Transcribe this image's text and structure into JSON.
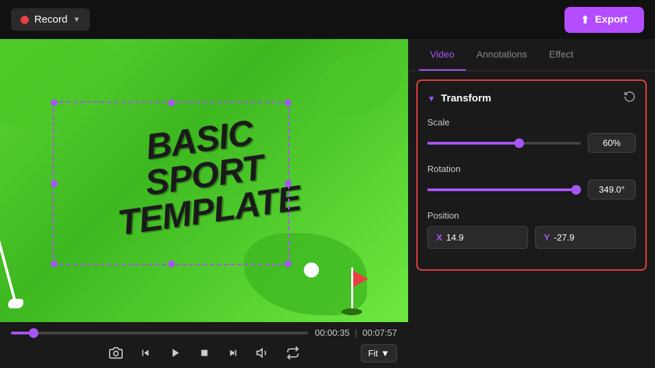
{
  "topbar": {
    "record_label": "Record",
    "export_label": "Export"
  },
  "tabs": {
    "video_label": "Video",
    "annotations_label": "Annotations",
    "effect_label": "Effect"
  },
  "transform": {
    "title": "Transform",
    "scale_label": "Scale",
    "scale_value": "60%",
    "scale_percent": 60,
    "rotation_label": "Rotation",
    "rotation_value": "349.0°",
    "rotation_percent": 97,
    "position_label": "Position",
    "position_x_label": "X",
    "position_x_value": "14.9",
    "position_y_label": "Y",
    "position_y_value": "-27.9"
  },
  "video": {
    "sport_text_line1": "BASIC SPORT",
    "sport_text_line2": "TEMPLATE",
    "current_time": "00:00:35",
    "total_time": "00:07:57",
    "fit_label": "Fit"
  },
  "controls": {
    "camera_icon": "📷",
    "rewind_icon": "◀",
    "play_icon": "▶",
    "stop_icon": "■",
    "forward_icon": "▶▶",
    "volume_icon": "🔊",
    "loop_icon": "↺"
  }
}
